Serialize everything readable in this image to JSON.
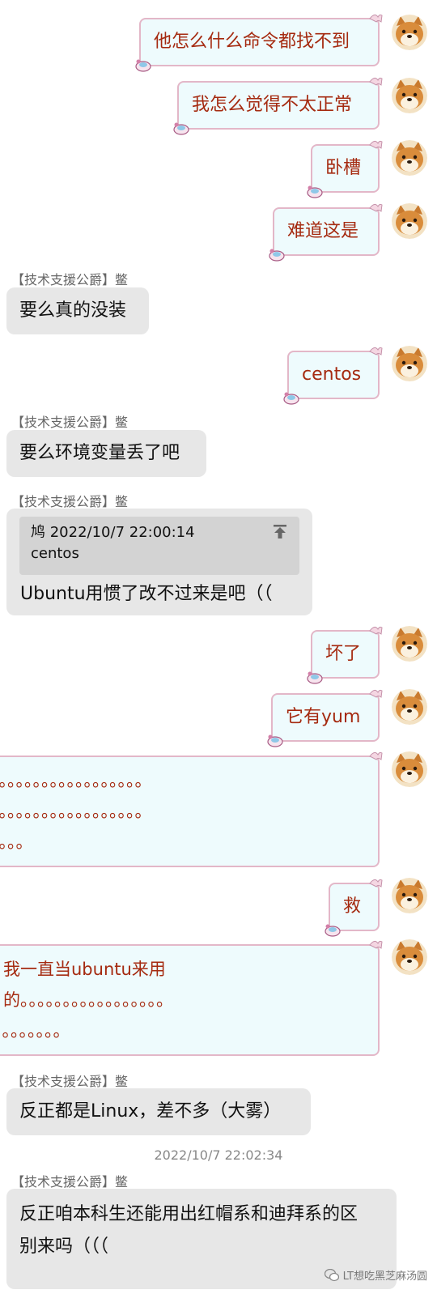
{
  "sender_name": "【技术支援公爵】鳖",
  "messages": {
    "m1": "他怎么什么命令都找不到",
    "m2": "我怎么觉得不太正常",
    "m3": "卧槽",
    "m4": "难道这是",
    "m5": "要么真的没装",
    "m6": "centos",
    "m7": "要么环境变量丢了吧",
    "m8_quote_header": "鸠  2022/10/7 22:00:14",
    "m8_quote_body": "centos",
    "m8": "Ubuntu用惯了改不过来是吧（（",
    "m9": "坏了",
    "m10": "它有yum",
    "m11_line1": "。。。。。。。。。。。。。。。。。。",
    "m11_line2": "。。。。。。。。。。。。。。。。。。",
    "m11_line3": "。。。。",
    "m12": "救",
    "m13_line1": "我一直当ubuntu来用",
    "m13_line2": "的。。。。。。。。。。。。。。。。。",
    "m13_line3": "。。。。。。。。",
    "m14": "反正都是Linux，差不多（大雾）",
    "m15_line1": "反正咱本科生还能用出红帽系和迪拜系的区",
    "m15_line2": "别来吗（（（"
  },
  "timestamp": "2022/10/7 22:02:34",
  "watermark": "LT想吃黑芝麻汤圆",
  "colors": {
    "self_bubble_bg": "#eefbfd",
    "self_bubble_border": "#e3b7c8",
    "self_text": "#a52a10",
    "other_bubble_bg": "#e7e7e7"
  },
  "icons": [
    "shiba-avatar",
    "pin-top-icon",
    "wechat-icon"
  ]
}
